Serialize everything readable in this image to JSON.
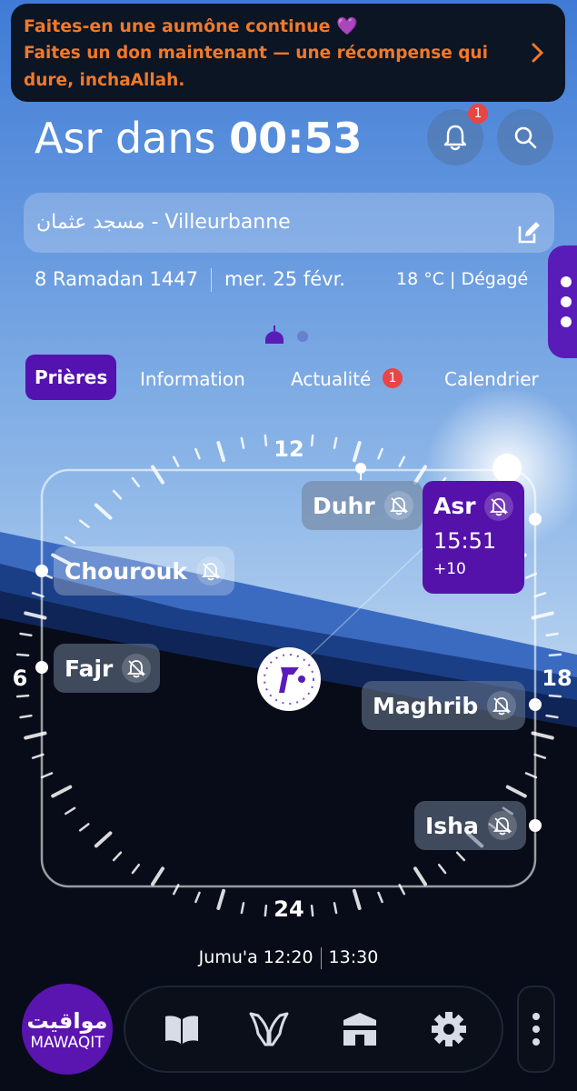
{
  "banner": {
    "line1": "Faites-en une aumône continue",
    "heart": "💜",
    "line2": "Faites un don maintenant — une récompense qui dure, inchaAllah.",
    "chevron_icon": "chevron-right-icon"
  },
  "header": {
    "countdown_prefix": "Asr dans",
    "countdown_value": "00:53",
    "notifications_badge": "1"
  },
  "mosque": {
    "name": "مسجد عثمان - Villeurbanne"
  },
  "dates": {
    "hijri": "8 Ramadan 1447",
    "gregorian": "mer. 25 févr.",
    "weather": "18 °C | Dégagé"
  },
  "tabs": {
    "prieres": "Prières",
    "information": "Information",
    "actualite": "Actualité",
    "actualite_badge": "1",
    "calendrier": "Calendrier"
  },
  "dial": {
    "label_12": "12",
    "label_6": "6",
    "label_18": "18",
    "label_24": "24"
  },
  "prayers": {
    "duhr": "Duhr",
    "asr": "Asr",
    "asr_time": "15:51",
    "asr_delay": "+10",
    "chourouk": "Chourouk",
    "fajr": "Fajr",
    "maghrib": "Maghrib",
    "isha": "Isha"
  },
  "jumua": {
    "label": "Jumu'a",
    "time1": "12:20",
    "time2": "13:30"
  },
  "logo": {
    "arabic": "مواقيت",
    "latin": "MAWAQIT"
  },
  "colors": {
    "accent": "#5412b0",
    "banner_text": "#f0792a",
    "badge": "#e84545"
  }
}
